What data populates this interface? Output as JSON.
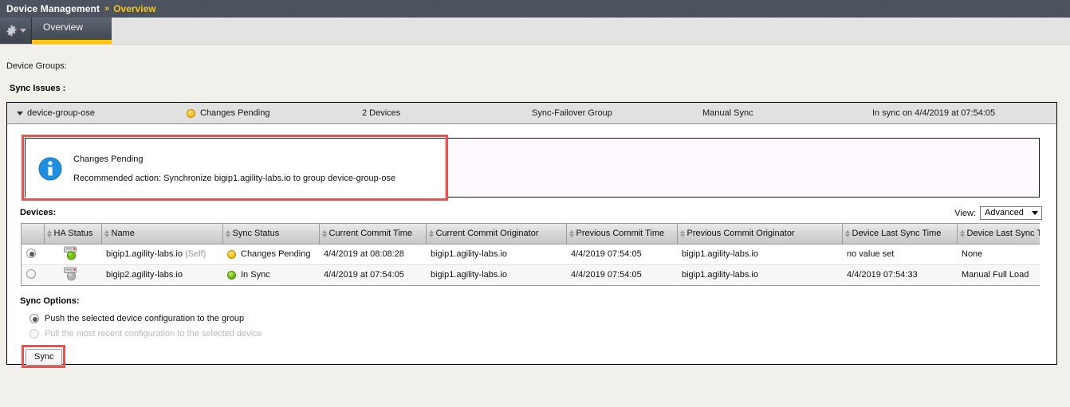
{
  "breadcrumb": {
    "main": "Device Management",
    "separator": "»",
    "current": "Overview"
  },
  "tabs": {
    "gear_icon": "gear-icon",
    "caret_icon": "chevron-down-icon",
    "items": [
      {
        "label": "Overview",
        "active": true
      }
    ]
  },
  "labels": {
    "device_groups": "Device Groups:",
    "sync_issues": "Sync Issues :",
    "devices": "Devices:",
    "sync_options": "Sync Options:",
    "view": "View:"
  },
  "group": {
    "name": "device-group-ose",
    "status": "Changes Pending",
    "status_dot": "yellow-status-dot",
    "devices_count": "2 Devices",
    "type": "Sync-Failover Group",
    "sync_mode": "Manual Sync",
    "last_sync": "In sync on 4/4/2019 at 07:54:05",
    "expand_icon": "caret-down-icon"
  },
  "info_box": {
    "icon": "info-icon",
    "title": "Changes Pending",
    "action": "Recommended action: Synchronize bigip1.agility-labs.io to group device-group-ose"
  },
  "view_select": {
    "value": "Advanced",
    "caret": "chevron-down-icon"
  },
  "devices_table": {
    "columns": [
      "",
      "HA Status",
      "Name",
      "Sync Status",
      "Current Commit Time",
      "Current Commit Originator",
      "Previous Commit Time",
      "Previous Commit Originator",
      "Device Last Sync Time",
      "Device Last Sync Type"
    ],
    "rows": [
      {
        "selected": true,
        "ha_status": "green",
        "name": "bigip1.agility-labs.io",
        "self_tag": "(Self)",
        "sync_status": "Changes Pending",
        "sync_status_dot": "yellow",
        "current_commit_time": "4/4/2019 at 08:08:28",
        "current_commit_originator": "bigip1.agility-labs.io",
        "previous_commit_time": "4/4/2019 07:54:05",
        "previous_commit_originator": "bigip1.agility-labs.io",
        "device_last_sync_time": "no value set",
        "device_last_sync_type": "None"
      },
      {
        "selected": false,
        "ha_status": "gray",
        "name": "bigip2.agility-labs.io",
        "self_tag": "",
        "sync_status": "In Sync",
        "sync_status_dot": "green",
        "current_commit_time": "4/4/2019 at 07:54:05",
        "current_commit_originator": "bigip1.agility-labs.io",
        "previous_commit_time": "4/4/2019 07:54:05",
        "previous_commit_originator": "bigip1.agility-labs.io",
        "device_last_sync_time": "4/4/2019 07:54:33",
        "device_last_sync_type": "Manual Full Load"
      }
    ]
  },
  "sync_options": {
    "push": "Push the selected device configuration to the group",
    "pull": "Pull the most recent configuration to the selected device",
    "push_selected": true,
    "pull_disabled": true
  },
  "sync_button": {
    "label": "Sync"
  },
  "colors": {
    "accent_yellow": "#ffc20e",
    "breadcrumb_bg": "#4b525e",
    "highlight_red": "#f74c47",
    "status_pending": "#ffcc33",
    "status_insync": "#7fc623",
    "info_blue": "#1f8fe0"
  }
}
